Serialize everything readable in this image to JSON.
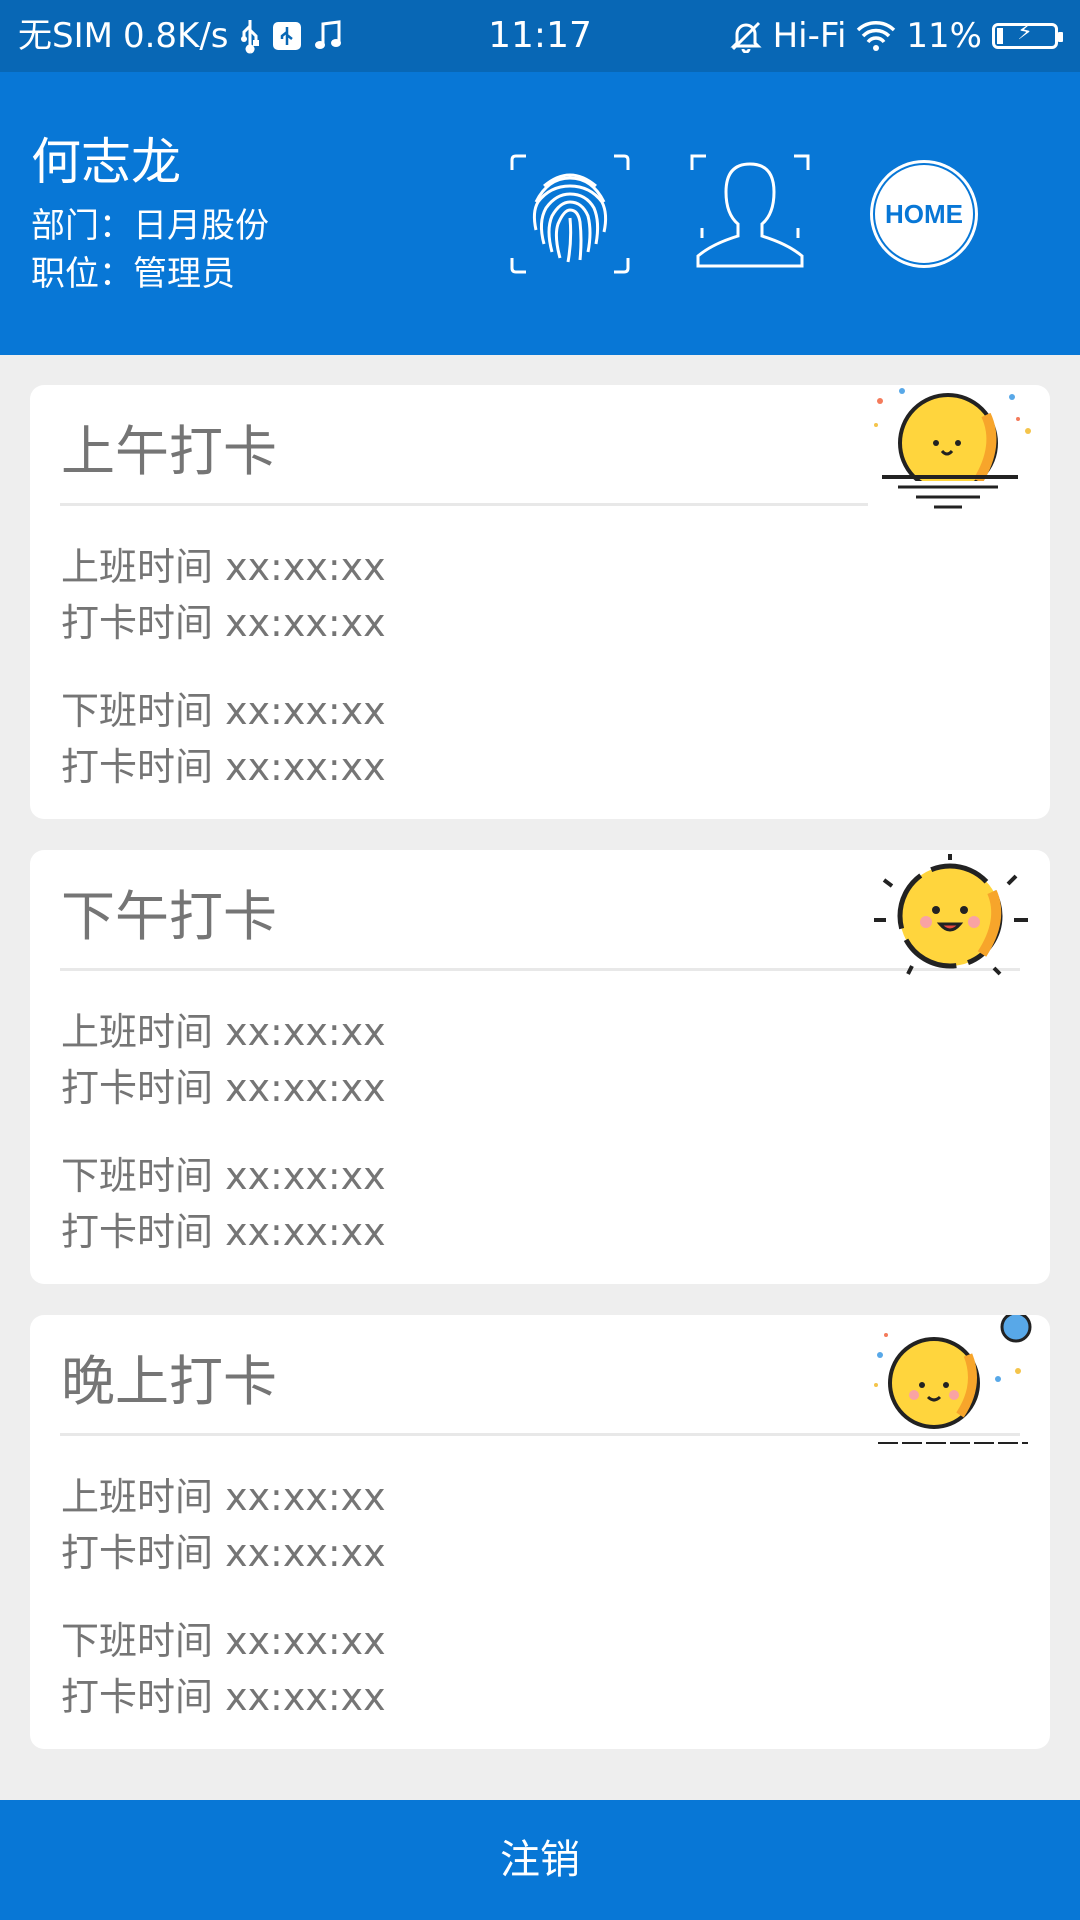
{
  "status_bar": {
    "carrier": "无SIM",
    "speed": "0.8K/s",
    "time": "11:17",
    "hifi": "Hi-Fi",
    "battery": "11%"
  },
  "header": {
    "name": "何志龙",
    "department": "部门：日月股份",
    "position": "职位：管理员",
    "home_label": "HOME"
  },
  "cards": [
    {
      "title": "上午打卡",
      "start_label": "上班时间  xx:xx:xx",
      "start_punch": "打卡时间 xx:xx:xx",
      "end_label": "下班时间  xx:xx:xx",
      "end_punch": "打卡时间 xx:xx:xx"
    },
    {
      "title": "下午打卡",
      "start_label": "上班时间 xx:xx:xx",
      "start_punch": "打卡时间 xx:xx:xx",
      "end_label": "下班时间 xx:xx:xx",
      "end_punch": "打卡时间 xx:xx:xx"
    },
    {
      "title": "晚上打卡",
      "start_label": "上班时间 xx:xx:xx",
      "start_punch": "打卡时间 xx:xx:xx",
      "end_label": "下班时间 xx:xx:xx",
      "end_punch": "打卡时间 xx:xx:xx"
    }
  ],
  "logout_label": "注销",
  "colors": {
    "status_bar": "#0867B5",
    "header": "#0877D6",
    "background": "#EEEEEE",
    "card": "#FFFFFF",
    "text_gray": "#757575",
    "sun_yellow": "#FFD53D"
  }
}
